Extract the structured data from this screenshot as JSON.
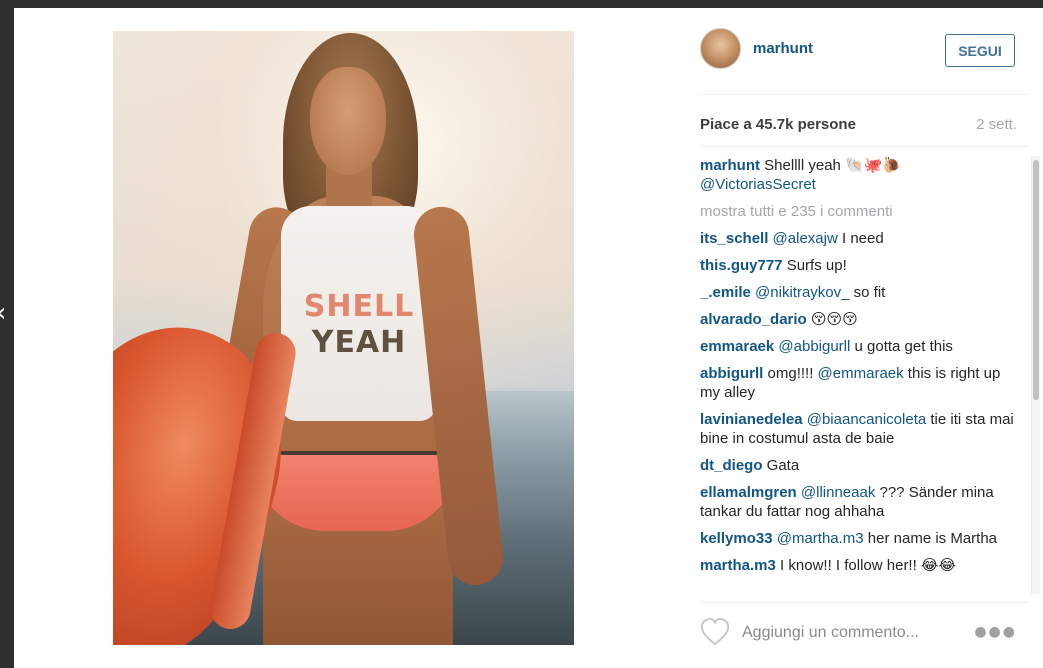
{
  "post": {
    "username": "marhunt",
    "follow_label": "SEGUI",
    "likes_text": "Piace a 45.7k persone",
    "time_ago": "2 sett.",
    "caption": {
      "user": "marhunt",
      "text": " Shellll yeah ",
      "emoji": "🐚🐙🐌",
      "mention": "@VictoriasSecret"
    },
    "show_all_label": "mostra tutti e 235 i commenti",
    "add_comment_placeholder": "Aggiungi un commento...",
    "photo_text": {
      "line1": "SHELL",
      "line2": "YEAH"
    }
  },
  "comments": [
    {
      "user": "its_schell",
      "mention": "@alexajw",
      "text": " I need"
    },
    {
      "user": "this.guy777",
      "mention": "",
      "text": "Surfs up!"
    },
    {
      "user": "_.emile",
      "mention": "@nikitraykov_",
      "text": "  so fit"
    },
    {
      "user": "alvarado_dario",
      "mention": "",
      "text": "😚😚😚"
    },
    {
      "user": "emmaraek",
      "mention": "@abbigurll",
      "text": " u gotta get this"
    },
    {
      "user": "abbigurll",
      "mention": "@emmaraek",
      "text": " this is right up my alley",
      "prefix": "omg!!!! "
    },
    {
      "user": "lavinianedelea",
      "mention": "@biaancanicoleta",
      "text": " tie iti sta mai bine in costumul asta de baie"
    },
    {
      "user": "dt_diego",
      "mention": "",
      "text": "Gata"
    },
    {
      "user": "ellamalmgren",
      "mention": "@llinneaak",
      "text": " ??? Sänder mina tankar du fattar nog ahhaha"
    },
    {
      "user": "kellymo33",
      "mention": "@martha.m3",
      "text": " her name is Martha"
    },
    {
      "user": "martha.m3",
      "mention": "",
      "text": "I know!! I follow her!! 😂😂"
    }
  ]
}
